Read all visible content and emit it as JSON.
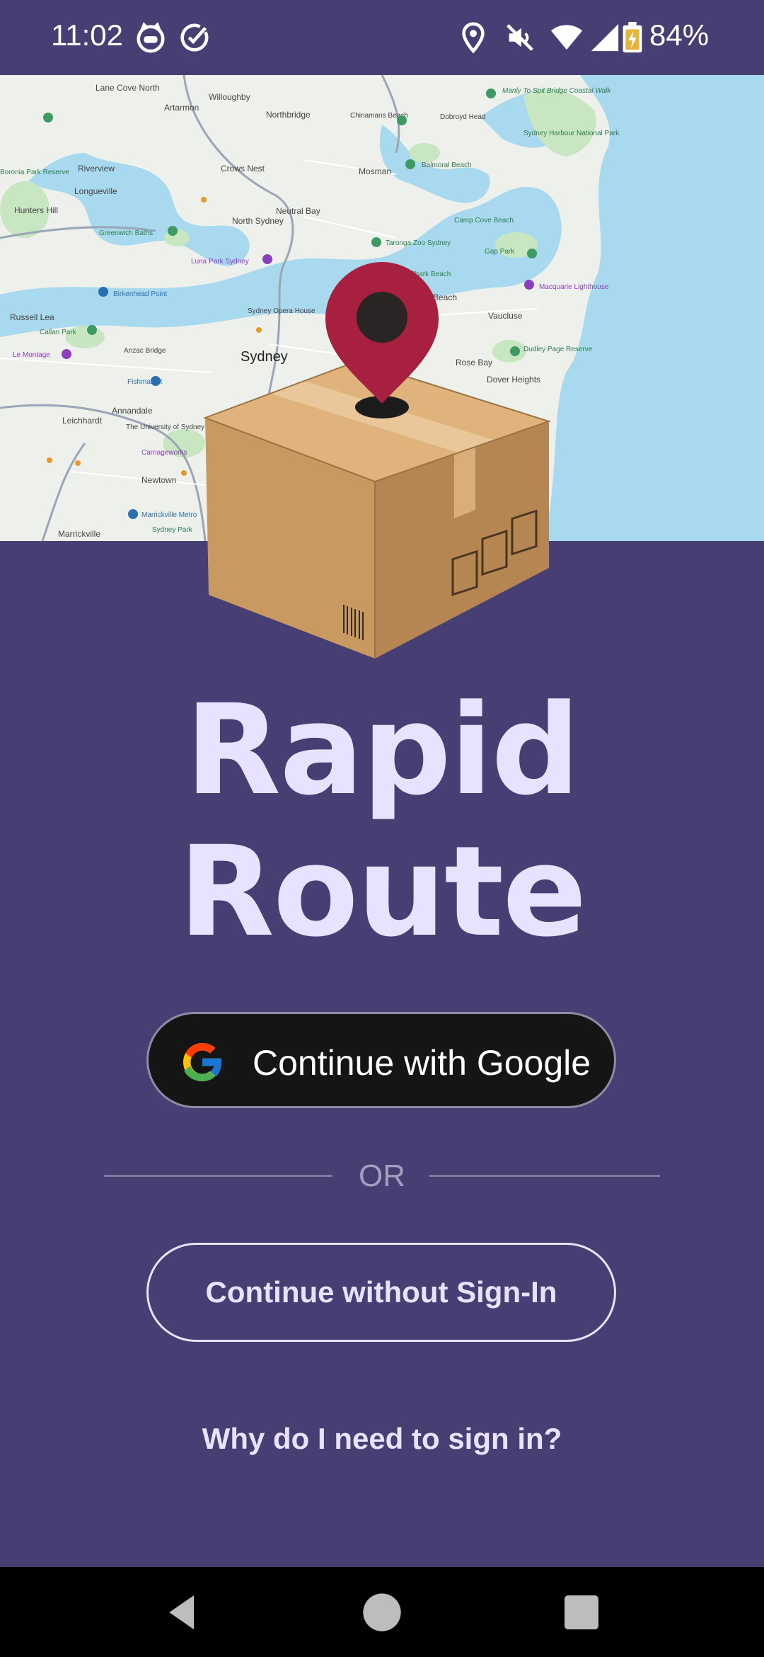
{
  "status_bar": {
    "time": "11:02",
    "battery": "84%",
    "icons": [
      "cat-icon",
      "check-circle-icon",
      "location-icon",
      "mute-icon",
      "wifi-icon",
      "signal-icon",
      "battery-icon"
    ]
  },
  "map": {
    "labels": [
      {
        "text": "Lane Cove North"
      },
      {
        "text": "Willoughby"
      },
      {
        "text": "Artarmon"
      },
      {
        "text": "Northbridge"
      },
      {
        "text": "Chinamans Beach"
      },
      {
        "text": "Dobroyd Head"
      },
      {
        "text": "Manly To Spit Bridge Coastal Walk"
      },
      {
        "text": "Sydney Harbour National Park"
      },
      {
        "text": "Riverview"
      },
      {
        "text": "Crows Nest"
      },
      {
        "text": "Mosman"
      },
      {
        "text": "Balmoral Beach"
      },
      {
        "text": "Longueville"
      },
      {
        "text": "Hunters Hill"
      },
      {
        "text": "Neutral Bay"
      },
      {
        "text": "North Sydney"
      },
      {
        "text": "Greenwich Baths"
      },
      {
        "text": "Camp Cove Beach"
      },
      {
        "text": "Taronga Zoo Sydney"
      },
      {
        "text": "Gap Park"
      },
      {
        "text": "Luna Park Sydney"
      },
      {
        "text": "Birkenhead Point"
      },
      {
        "text": "Shark Beach"
      },
      {
        "text": "Macquarie Lighthouse"
      },
      {
        "text": "Russell Lea"
      },
      {
        "text": "Sydney Opera House"
      },
      {
        "text": "Vaucluse"
      },
      {
        "text": "Callan Park"
      },
      {
        "text": "Le Montage"
      },
      {
        "text": "Anzac Bridge"
      },
      {
        "text": "Sydney"
      },
      {
        "text": "Rose Bay"
      },
      {
        "text": "Dudley Page Reserve"
      },
      {
        "text": "Dover Heights"
      },
      {
        "text": "Fishmarket"
      },
      {
        "text": "Annandale"
      },
      {
        "text": "Leichhardt"
      },
      {
        "text": "The University of Sydney"
      },
      {
        "text": "Carriageworks"
      },
      {
        "text": "Newtown"
      },
      {
        "text": "Marrickville Metro"
      },
      {
        "text": "Marrickville"
      },
      {
        "text": "Sydney Park"
      },
      {
        "text": "Boronia Park Reserve"
      },
      {
        "text": "Beach"
      }
    ]
  },
  "app": {
    "title_line1": "Rapid",
    "title_line2": "Route"
  },
  "auth": {
    "google_button": "Continue with Google",
    "or_text": "OR",
    "guest_button": "Continue without Sign-In",
    "why_link": "Why do I need to sign in?"
  },
  "colors": {
    "background": "#473e73",
    "title": "#e6e2ff",
    "google_button_bg": "#151515",
    "pin": "#a8203f",
    "box": "#c89a62",
    "water": "#a8d9ef"
  },
  "nav": {
    "buttons": [
      "back-icon",
      "home-icon",
      "recents-icon"
    ]
  }
}
